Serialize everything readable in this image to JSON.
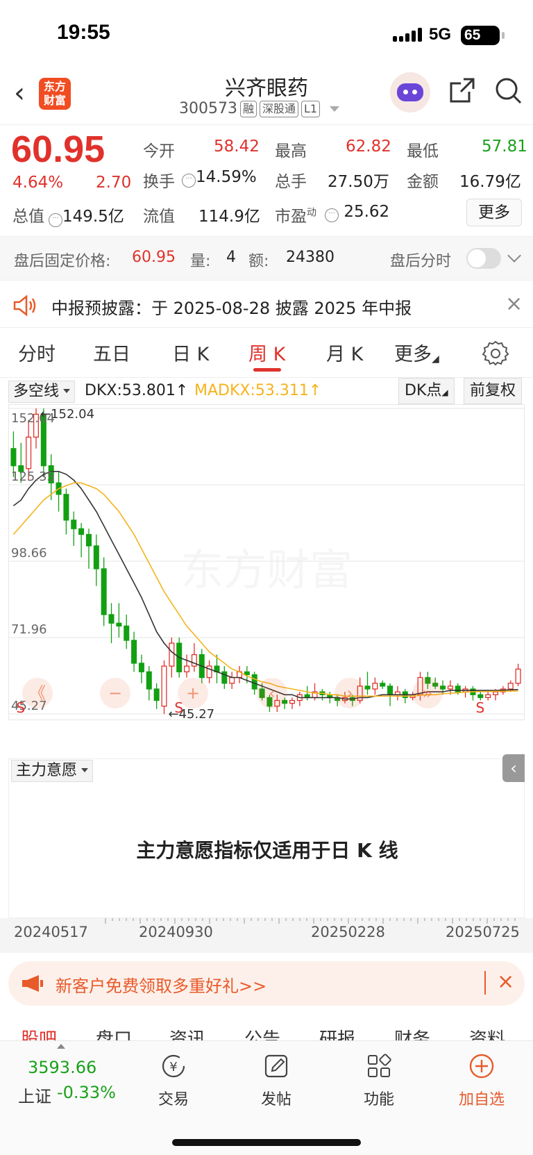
{
  "status": {
    "time": "19:55",
    "network": "5G",
    "battery": "65"
  },
  "header": {
    "logo_text": "东方财富",
    "name": "兴齐眼药",
    "code": "300573",
    "tags": [
      "融",
      "深股通",
      "L1"
    ]
  },
  "quote": {
    "price": "60.95",
    "change_pct": "4.64%",
    "change": "2.70",
    "open_label": "今开",
    "open": "58.42",
    "high_label": "最高",
    "high": "62.82",
    "low_label": "最低",
    "low": "57.81",
    "turnover_label": "换手",
    "turnover": "14.59%",
    "volume_label": "总手",
    "volume": "27.50万",
    "amount_label": "金额",
    "amount": "16.79亿",
    "mcap_label": "总值",
    "mcap": "149.5亿",
    "float_label": "流值",
    "float": "114.9亿",
    "pe_label": "市盈",
    "pe_sup": "动",
    "pe": "25.62",
    "more_label": "更多"
  },
  "after_hours": {
    "price_label": "盘后固定价格:",
    "price": "60.95",
    "vol_label": "量:",
    "vol": "4",
    "amt_label": "额:",
    "amt": "24380",
    "timeline_label": "盘后分时"
  },
  "notice": {
    "text": "中报预披露：于 2025-08-28 披露 2025 年中报"
  },
  "tabs": [
    "分时",
    "五日",
    "日 K",
    "周 K",
    "月 K",
    "更多"
  ],
  "active_tab": "周 K",
  "indicator": {
    "selector": "多空线",
    "dkx": "DKX:53.801↑",
    "madkx": "MADKX:53.311↑",
    "dk_button": "DK点",
    "adjust_button": "前复权"
  },
  "colors": {
    "up": "#e0312b",
    "down": "#12a012",
    "dkx": "#333333",
    "madkx": "#f5b31c"
  },
  "chart_data": {
    "type": "candlestick",
    "y_ticks": [
      "152.04",
      "125.35",
      "98.66",
      "71.96",
      "45.27"
    ],
    "ylim": [
      45.27,
      152.04
    ],
    "max_label": "152.04",
    "min_label": "45.27",
    "watermark": "东方财富",
    "candles": [
      [
        138,
        132,
        144,
        128
      ],
      [
        132,
        130,
        140,
        126
      ],
      [
        131,
        142,
        148,
        127
      ],
      [
        142,
        150,
        152.04,
        138
      ],
      [
        150,
        132,
        152,
        128
      ],
      [
        132,
        126,
        136,
        120
      ],
      [
        126,
        122,
        130,
        116
      ],
      [
        122,
        113,
        124,
        108
      ],
      [
        113,
        110,
        116,
        104
      ],
      [
        110,
        108,
        112,
        100
      ],
      [
        108,
        104,
        110,
        96
      ],
      [
        104,
        96,
        108,
        90
      ],
      [
        96,
        80,
        100,
        76
      ],
      [
        80,
        77,
        84,
        70
      ],
      [
        77,
        76,
        84,
        72
      ],
      [
        76,
        71,
        80,
        68
      ],
      [
        71,
        63,
        74,
        60
      ],
      [
        63,
        60,
        66,
        56
      ],
      [
        60,
        54,
        62,
        50
      ],
      [
        54,
        50,
        56,
        47
      ],
      [
        48,
        62,
        64,
        45.27
      ],
      [
        62,
        70,
        72,
        58
      ],
      [
        70,
        60,
        72,
        58
      ],
      [
        60,
        62,
        66,
        58
      ],
      [
        62,
        66,
        70,
        60
      ],
      [
        66,
        58,
        68,
        56
      ],
      [
        58,
        62,
        64,
        56
      ],
      [
        62,
        60,
        66,
        56
      ],
      [
        60,
        56,
        62,
        54
      ],
      [
        56,
        58,
        60,
        54
      ],
      [
        58,
        60,
        62,
        56
      ],
      [
        60,
        59,
        62,
        56
      ],
      [
        59,
        54,
        60,
        52
      ],
      [
        54,
        51,
        56,
        50
      ],
      [
        51,
        48,
        52,
        46
      ],
      [
        48,
        50,
        52,
        46
      ],
      [
        50,
        49,
        51,
        47
      ],
      [
        49,
        50,
        51,
        47
      ],
      [
        50,
        52,
        53,
        48
      ],
      [
        52,
        51,
        55,
        50
      ],
      [
        51,
        53,
        56,
        50
      ],
      [
        53,
        52,
        54,
        50
      ],
      [
        52,
        51,
        53,
        49
      ],
      [
        51,
        50,
        52,
        48
      ],
      [
        50,
        51,
        53,
        49
      ],
      [
        51,
        50,
        52,
        48
      ],
      [
        50,
        55,
        58,
        49
      ],
      [
        55,
        54,
        60,
        52
      ],
      [
        54,
        56,
        58,
        52
      ],
      [
        56,
        55,
        57,
        54
      ],
      [
        55,
        52,
        56,
        48
      ],
      [
        52,
        53,
        55,
        50
      ],
      [
        53,
        51,
        54,
        49
      ],
      [
        51,
        52,
        53,
        50
      ],
      [
        52,
        58,
        60,
        50
      ],
      [
        58,
        56,
        60,
        54
      ],
      [
        56,
        55,
        58,
        54
      ],
      [
        55,
        54,
        57,
        52
      ],
      [
        54,
        55,
        57,
        52
      ],
      [
        55,
        53,
        56,
        52
      ],
      [
        53,
        54,
        55,
        51
      ],
      [
        54,
        52,
        55,
        50
      ],
      [
        52,
        51,
        53,
        50
      ],
      [
        51,
        52,
        53,
        50
      ],
      [
        52,
        53,
        54,
        50
      ],
      [
        53,
        54,
        55,
        52
      ],
      [
        54,
        56,
        57,
        53
      ],
      [
        56,
        60.95,
        62.82,
        55
      ]
    ],
    "signals": [
      {
        "label": "S",
        "index": 0,
        "color": "#e0312b"
      },
      {
        "label": "S",
        "index": 21,
        "color": "#e0312b"
      },
      {
        "label": "S",
        "index": 61,
        "color": "#e0312b"
      }
    ],
    "dkx": [
      118,
      120,
      124,
      127,
      129,
      130,
      130,
      129,
      127,
      124,
      120,
      116,
      111,
      106,
      101,
      96,
      91,
      86,
      80,
      74,
      70,
      67,
      65,
      64,
      63,
      62,
      61,
      60,
      59,
      58,
      58,
      57,
      56,
      55,
      54,
      53,
      52,
      52,
      51,
      51,
      51,
      51,
      51,
      51,
      50.5,
      50.5,
      51,
      51,
      51.5,
      52,
      52,
      52,
      52,
      52,
      52.5,
      53,
      53,
      53,
      53.5,
      53.5,
      53.5,
      53.5,
      53.5,
      53.5,
      53.5,
      53.6,
      53.7,
      53.8
    ],
    "madkx": [
      108,
      111,
      114,
      117,
      120,
      122,
      124,
      125,
      126,
      126,
      125,
      124,
      122,
      119,
      116,
      112,
      108,
      103,
      98,
      93,
      88,
      84,
      80,
      76,
      73,
      70,
      67,
      65,
      63,
      61,
      60,
      58.5,
      57.5,
      56.5,
      56,
      55,
      54.5,
      54,
      53.5,
      53,
      52.5,
      52.5,
      52,
      52,
      51.5,
      51.5,
      51.5,
      51.5,
      51.5,
      51.5,
      51.5,
      51.5,
      51.5,
      51.5,
      51.8,
      52,
      52,
      52.3,
      52.5,
      52.7,
      52.9,
      53,
      53.1,
      53.1,
      53.2,
      53.2,
      53.3,
      53.3
    ]
  },
  "main_force": {
    "selector": "主力意愿",
    "message": "主力意愿指标仅适用于日 K 线"
  },
  "dates": [
    "20240517",
    "20240930",
    "20250228",
    "20250725"
  ],
  "promo": {
    "text": "新客户免费领取多重好礼>>"
  },
  "subtabs": [
    "股吧",
    "盘口",
    "资讯",
    "公告",
    "研报",
    "财务",
    "资料"
  ],
  "bottom_nav": {
    "index_value": "3593.66",
    "index_name": "上证",
    "index_change": "-0.33%",
    "items": [
      {
        "label": "交易",
        "icon": "trade-icon"
      },
      {
        "label": "发帖",
        "icon": "edit-icon"
      },
      {
        "label": "功能",
        "icon": "grid-icon"
      },
      {
        "label": "加自选",
        "icon": "add-circle-icon"
      }
    ]
  }
}
